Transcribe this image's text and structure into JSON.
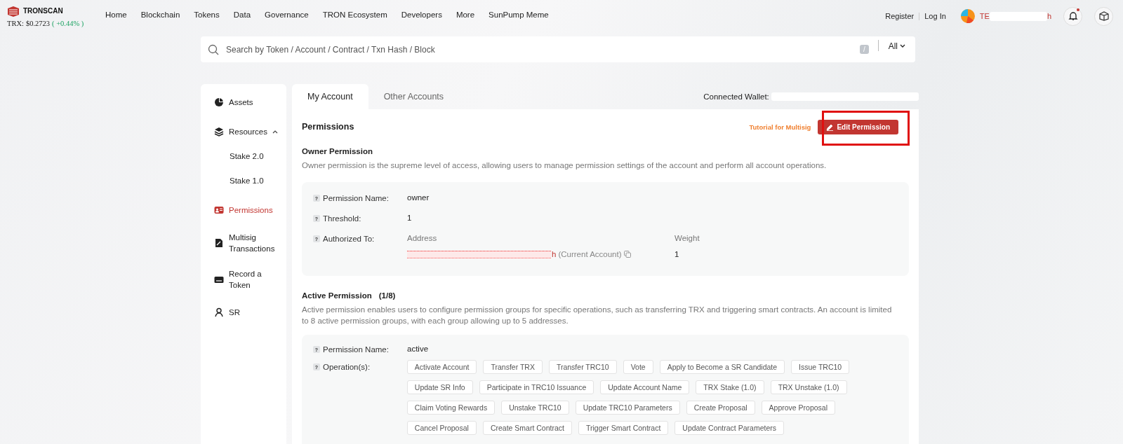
{
  "header": {
    "logo": "TRONSCAN",
    "price_label": "TRX:",
    "price": "$0.2723",
    "change": "( +0.44% )",
    "nav": [
      "Home",
      "Blockchain",
      "Tokens",
      "Data",
      "Governance",
      "TRON Ecosystem",
      "Developers",
      "More",
      "SunPump Meme"
    ],
    "register": "Register",
    "login": "Log In",
    "user_start": "TE",
    "user_end": "h",
    "notification_dot": true
  },
  "search": {
    "placeholder": "Search by Token / Account / Contract / Txn Hash / Block",
    "shortcut": "/",
    "scope": "All"
  },
  "sidebar": {
    "items": [
      {
        "label": "Assets",
        "selected": false
      },
      {
        "label": "Resources",
        "selected": false,
        "expanded": true,
        "children": [
          {
            "label": "Stake 2.0",
            "selected": false
          },
          {
            "label": "Stake 1.0",
            "selected": false
          }
        ]
      },
      {
        "label": "Permissions",
        "selected": true
      },
      {
        "label": "Multisig Transactions",
        "selected": false
      },
      {
        "label": "Record a Token",
        "selected": false
      },
      {
        "label": "SR",
        "selected": false
      }
    ]
  },
  "tabs": [
    {
      "label": "My Account",
      "selected": true
    },
    {
      "label": "Other Accounts",
      "selected": false
    }
  ],
  "connected_wallet": "Connected Wallet: ",
  "permissions": {
    "title": "Permissions",
    "tutorial": "Tutorial for Multisig",
    "edit_button": "Edit Permission",
    "highlighted": true
  },
  "owner": {
    "title": "Owner Permission",
    "description": "Owner permission is the supreme level of access, allowing users to manage permission settings of the account and perform all account operations.",
    "name_help": "?",
    "name_label": "Permission Name:",
    "name": "owner",
    "threshold_help": "?",
    "threshold_label": "Threshold:",
    "threshold": "1",
    "authorized_help": "?",
    "authorized_label": "Authorized To:",
    "address_header": "Address",
    "weight_header": "Weight",
    "address_end": "h",
    "address_note": "(Current Account)",
    "weight": "1"
  },
  "active": {
    "title": "Active Permission",
    "count": "(1/8)",
    "description": "Active permission enables users to configure permission groups for specific operations, such as transferring TRX and triggering smart contracts. An account is limited to 8 active permission groups, with each group allowing up to 5 addresses.",
    "name_help": "?",
    "name_label": "Permission Name:",
    "name": "active",
    "operations_help": "?",
    "operations_label": "Operation(s):",
    "operations": [
      "Activate Account",
      "Transfer TRX",
      "Transfer TRC10",
      "Vote",
      "Apply to Become a SR Candidate",
      "Issue TRC10",
      "Update SR Info",
      "Participate in TRC10 Issuance",
      "Update Account Name",
      "TRX Stake (1.0)",
      "TRX Unstake (1.0)",
      "Claim Voting Rewards",
      "Unstake TRC10",
      "Update TRC10 Parameters",
      "Create Proposal",
      "Approve Proposal",
      "Cancel Proposal",
      "Create Smart Contract",
      "Trigger Smart Contract",
      "Update Contract Parameters"
    ]
  }
}
